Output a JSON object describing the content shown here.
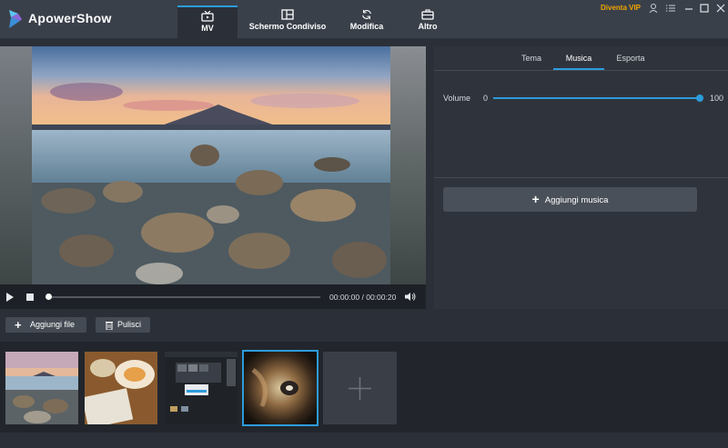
{
  "app": {
    "title": "ApowerShow",
    "vip_label": "Diventa VIP"
  },
  "nav": {
    "tabs": [
      {
        "label": "MV",
        "icon": "tv-icon"
      },
      {
        "label": "Schermo Condiviso",
        "icon": "split-screen-icon"
      },
      {
        "label": "Modifica",
        "icon": "refresh-icon"
      },
      {
        "label": "Altro",
        "icon": "briefcase-icon"
      }
    ],
    "active": "MV"
  },
  "player": {
    "time_current": "00:00:00",
    "time_separator": "/",
    "time_total": "00:00:20",
    "progress": 0
  },
  "panel": {
    "tabs": [
      "Tema",
      "Musica",
      "Esporta"
    ],
    "active_tab": "Musica",
    "volume_label": "Volume",
    "volume_min": "0",
    "volume_max": "100",
    "volume_value": 100,
    "add_music_label": "Aggiungi musica"
  },
  "toolbar": {
    "add_file_label": "Aggiungi file",
    "clear_label": "Pulisci"
  },
  "media": {
    "thumbnails": [
      "seascape",
      "breakfast-book",
      "app-screenshot",
      "abstract-blur"
    ],
    "selected_index": 3
  },
  "colors": {
    "accent": "#2d9cdb",
    "vip": "#f0a500",
    "background": "#2b3038"
  }
}
